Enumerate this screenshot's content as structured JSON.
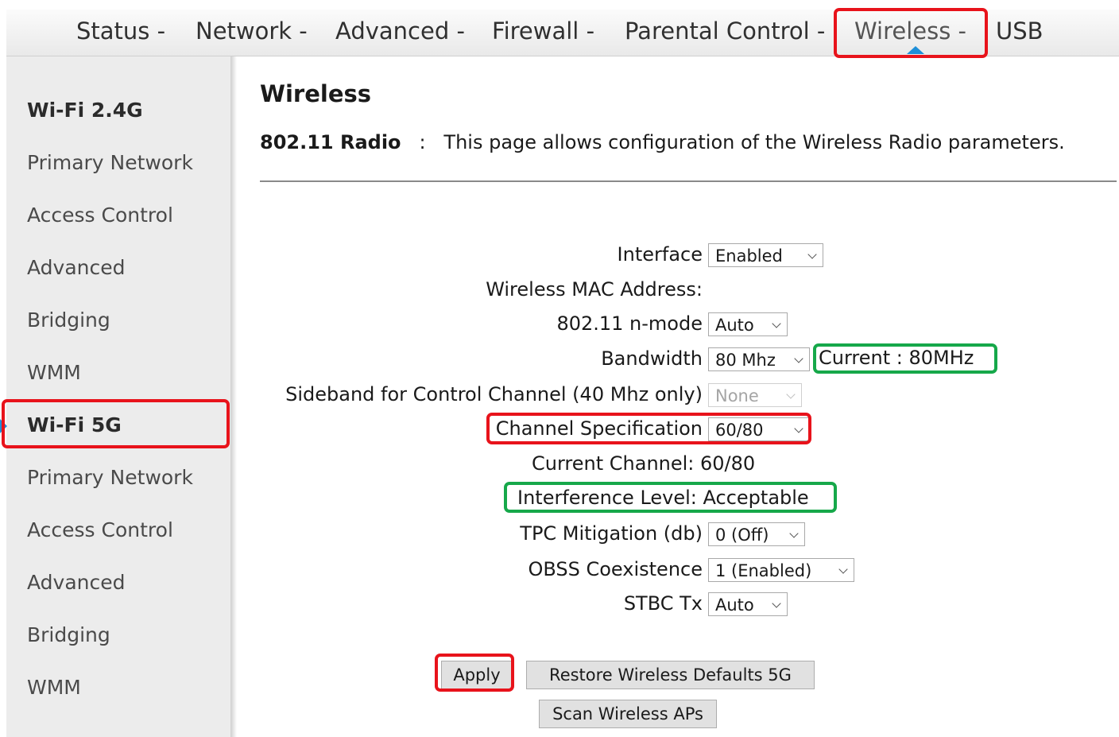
{
  "topnav": {
    "items": [
      "Status -",
      "Network -",
      "Advanced -",
      "Firewall -",
      "Parental Control -",
      "Wireless -",
      "USB"
    ],
    "active": "Wireless -"
  },
  "sidebar": {
    "groups": [
      {
        "header": "Wi-Fi 2.4G",
        "items": [
          "Primary Network",
          "Access Control",
          "Advanced",
          "Bridging",
          "WMM"
        ]
      },
      {
        "header": "Wi-Fi 5G",
        "items": [
          "Primary Network",
          "Access Control",
          "Advanced",
          "Bridging",
          "WMM"
        ]
      }
    ],
    "active": "Wi-Fi 5G"
  },
  "main": {
    "title": "Wireless",
    "desc_label": "802.11 Radio",
    "desc_sep": ":",
    "desc_text": "This page allows configuration of the Wireless Radio parameters.",
    "form": {
      "interface": {
        "label": "Interface",
        "value": "Enabled"
      },
      "mac": {
        "label": "Wireless MAC Address:"
      },
      "nmode": {
        "label": "802.11 n-mode",
        "value": "Auto"
      },
      "bandwidth": {
        "label": "Bandwidth",
        "value": "80 Mhz",
        "current": "Current :  80MHz"
      },
      "sideband": {
        "label": "Sideband for Control Channel (40 Mhz only)",
        "value": "None"
      },
      "channel_spec": {
        "label": "Channel Specification",
        "value": "60/80"
      },
      "current_channel": "Current Channel: 60/80",
      "interference": "Interference Level: Acceptable",
      "tpc": {
        "label": "TPC Mitigation (db)",
        "value": "0 (Off)"
      },
      "obss": {
        "label": "OBSS Coexistence",
        "value": "1 (Enabled)"
      },
      "stbc": {
        "label": "STBC Tx",
        "value": "Auto"
      }
    },
    "buttons": {
      "apply": "Apply",
      "restore": "Restore Wireless Defaults 5G",
      "scan": "Scan Wireless APs"
    }
  },
  "colors": {
    "highlight_red": "#e8131b",
    "highlight_green": "#16a84a",
    "active_indicator": "#1e8fd8"
  }
}
